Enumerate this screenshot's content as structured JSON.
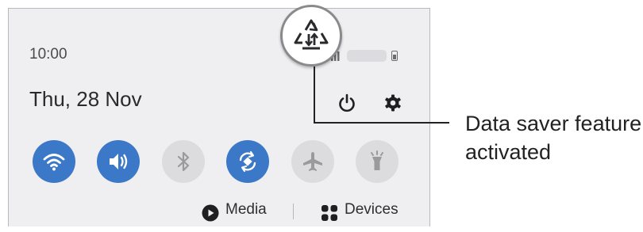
{
  "status_bar": {
    "time": "10:00"
  },
  "header": {
    "date": "Thu, 28 Nov",
    "power_icon": "power-icon",
    "settings_icon": "gear-icon"
  },
  "quick_settings": [
    {
      "name": "wifi",
      "icon": "wifi-icon",
      "active": true
    },
    {
      "name": "sound",
      "icon": "volume-icon",
      "active": true
    },
    {
      "name": "bluetooth",
      "icon": "bluetooth-icon",
      "active": false
    },
    {
      "name": "auto-rotate",
      "icon": "rotate-icon",
      "active": true
    },
    {
      "name": "airplane",
      "icon": "airplane-icon",
      "active": false
    },
    {
      "name": "flashlight",
      "icon": "flashlight-icon",
      "active": false
    }
  ],
  "bottom_bar": {
    "media_label": "Media",
    "devices_label": "Devices"
  },
  "callout": {
    "label_line1": "Data saver feature",
    "label_line2": "activated",
    "icon": "data-saver-icon"
  },
  "colors": {
    "accent": "#3b78c8",
    "inactive": "#dcdcdf",
    "panel": "#efeff1"
  }
}
